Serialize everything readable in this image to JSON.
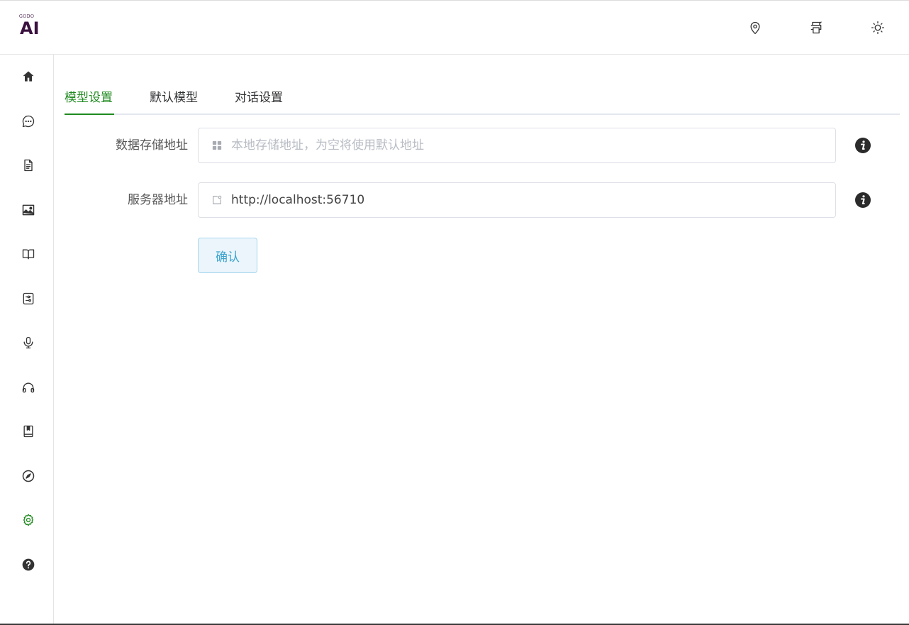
{
  "brand": {
    "small": "GODO",
    "big": "AI",
    "color": "#3b1140"
  },
  "header_icons": [
    "location-icon",
    "printer-icon",
    "sun-icon"
  ],
  "sidebar": {
    "items": [
      {
        "icon": "home-icon"
      },
      {
        "icon": "chat-icon"
      },
      {
        "icon": "document-icon"
      },
      {
        "icon": "image-icon"
      },
      {
        "icon": "book-open-icon"
      },
      {
        "icon": "sliders-icon"
      },
      {
        "icon": "microphone-icon"
      },
      {
        "icon": "headphones-icon"
      },
      {
        "icon": "bookmark-book-icon"
      },
      {
        "icon": "compass-icon"
      },
      {
        "icon": "gear-icon",
        "active": true
      },
      {
        "icon": "help-icon"
      }
    ],
    "active_color": "#1f8a1f"
  },
  "tabs": [
    {
      "label": "模型设置",
      "active": true
    },
    {
      "label": "默认模型",
      "active": false
    },
    {
      "label": "对话设置",
      "active": false
    }
  ],
  "form": {
    "storage": {
      "label": "数据存储地址",
      "value": "",
      "placeholder": "本地存储地址，为空将使用默认地址"
    },
    "server": {
      "label": "服务器地址",
      "value": "http://localhost:56710",
      "placeholder": ""
    },
    "confirm_label": "确认"
  },
  "colors": {
    "accent": "#1f8a1f",
    "button_text": "#3aa4cf",
    "button_bg": "#ecf5fb"
  }
}
